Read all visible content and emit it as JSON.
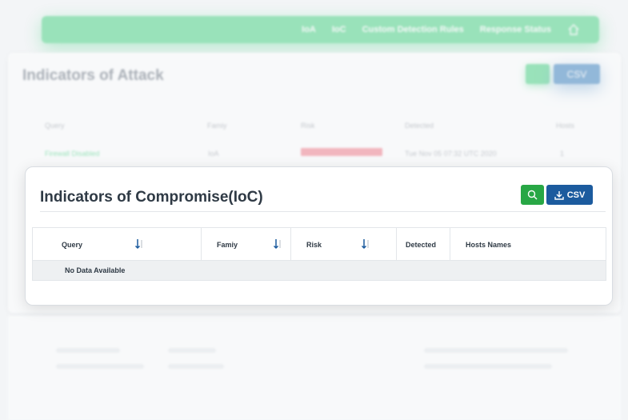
{
  "nav": {
    "items": [
      "IoA",
      "IoC",
      "Custom Detection Rules",
      "Response Status"
    ]
  },
  "background_page": {
    "title": "Indicators of Attack",
    "csv_label": "CSV",
    "columns": [
      "Query",
      "Famiy",
      "Risk",
      "Detected",
      "Hosts"
    ],
    "row": {
      "query": "Firewall Disabled",
      "family": "IoA",
      "detected": "Tue Nov 05 07:32 UTC 2020",
      "hosts": "1"
    }
  },
  "modal": {
    "title": "Indicators of Compromise(IoC)",
    "csv_label": "CSV",
    "columns": [
      "Query",
      "Famiy",
      "Risk",
      "Detected",
      "Hosts Names"
    ],
    "empty_message": "No Data Available"
  },
  "colors": {
    "primary_green": "#28a745",
    "primary_blue": "#1c5b9e",
    "nav_green": "#2ecc71",
    "risk_red": "#f06a7a"
  },
  "icons": {
    "search": "search-icon",
    "download": "download-icon",
    "sort": "sort-icon",
    "home": "home-icon"
  }
}
